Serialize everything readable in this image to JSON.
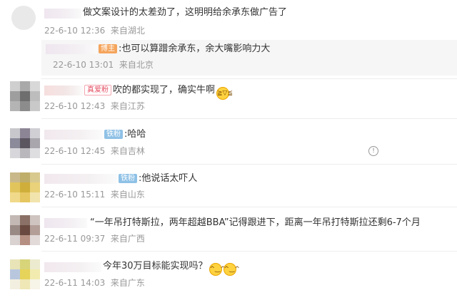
{
  "comments": [
    {
      "text": "做文案设计的太差劲了，这明明给余承东做广告了",
      "date": "22-6-10 12:36",
      "location": "来自湖北"
    },
    {
      "text": "吹的都实现了，确实牛啊",
      "badge": "真爱粉",
      "date": "22-6-10 12:43",
      "location": "来自江苏",
      "emoji": "laugh-emoji"
    },
    {
      "text": ":哈哈",
      "badge": "铁粉",
      "date": "22-6-10 12:45",
      "location": "来自吉林",
      "more_icon": "!"
    },
    {
      "text": ":他说话太吓人",
      "badge": "铁粉",
      "date": "22-6-10 15:11",
      "location": "来自山东"
    },
    {
      "text": "“一年吊打特斯拉，两年超越BBA”记得跟进下，距离一年吊打特斯拉还剩6-7个月",
      "date": "22-6-11 09:37",
      "location": "来自广西"
    },
    {
      "text": "今年30万目标能实现吗？",
      "date": "22-6-11 14:03",
      "location": "来自广东",
      "emoji": "smile-emoji"
    }
  ],
  "reply": {
    "badge": "博主",
    "text": ":也可以算蹭余承东，余大嘴影响力大",
    "date": "22-6-10 13:01",
    "location": "来自北京"
  }
}
